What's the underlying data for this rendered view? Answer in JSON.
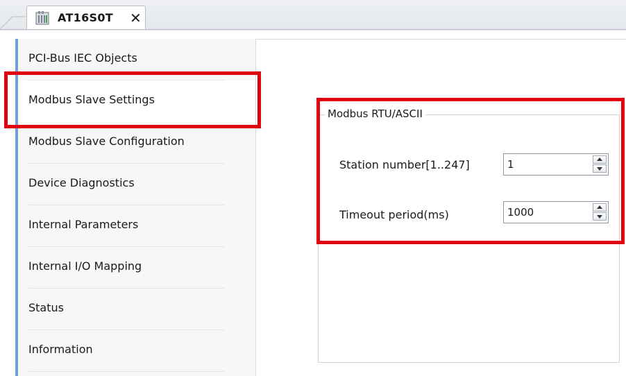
{
  "tab": {
    "title": "AT16S0T",
    "close_glyph": "✕",
    "icon": "device-module-icon"
  },
  "nav": {
    "items": [
      {
        "label": "PCI-Bus IEC Objects",
        "selected": false
      },
      {
        "label": "Modbus Slave Settings",
        "selected": true
      },
      {
        "label": "Modbus Slave Configuration",
        "selected": false
      },
      {
        "label": "Device Diagnostics",
        "selected": false
      },
      {
        "label": "Internal Parameters",
        "selected": false
      },
      {
        "label": "Internal I/O Mapping",
        "selected": false
      },
      {
        "label": "Status",
        "selected": false
      },
      {
        "label": "Information",
        "selected": false
      }
    ]
  },
  "settings": {
    "group_title": "Modbus RTU/ASCII",
    "station_number": {
      "label": "Station number[1..247]",
      "value": "1"
    },
    "timeout_period": {
      "label": "Timeout period(ms)",
      "value": "1000"
    }
  },
  "colors": {
    "highlight": "#e0000f",
    "nav_accent": "#6fa1d6"
  }
}
